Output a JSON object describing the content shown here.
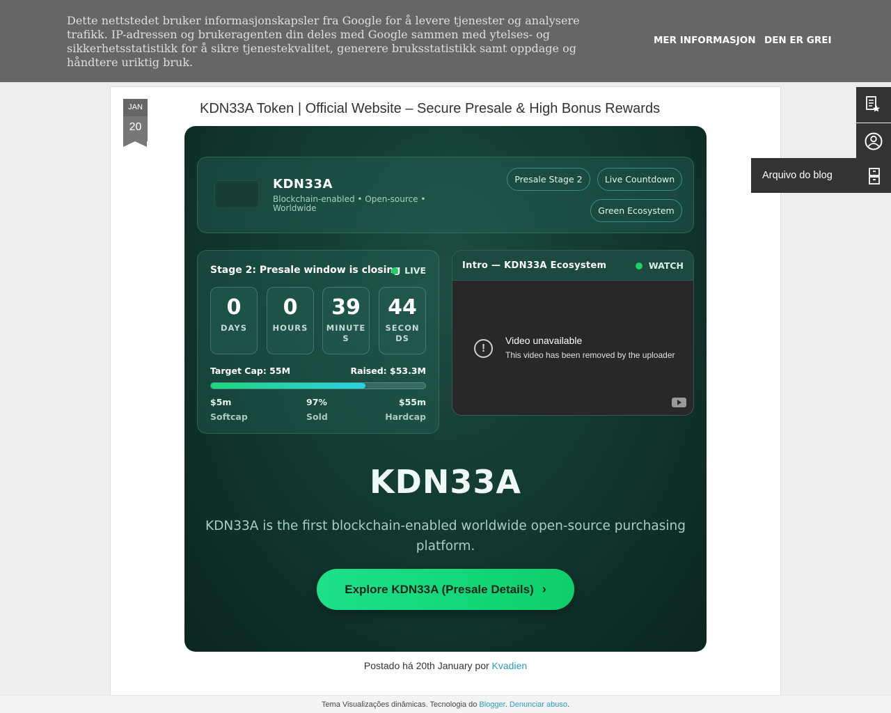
{
  "cookie": {
    "text": "Dette nettstedet bruker informasjonskapsler fra Google for å levere tjenester og analysere trafikk. IP-adressen og brukeragenten din deles med Google sammen med ytelses- og sikkerhetsstatistikk for å sikre tjenestekvalitet, generere bruksstatistikk samt oppdage og håndtere uriktig bruk.",
    "more_label": "MER INFORMASJON",
    "ok_label": "DEN ER GREI"
  },
  "post": {
    "month": "JAN",
    "day": "20",
    "title": "KDN33A Token | Official Website – Secure Presale & High Bonus Rewards",
    "byline_prefix": "Postado há 20th January por ",
    "author": "Kvadien"
  },
  "hero": {
    "brand": "KDN33A",
    "tags": "Blockchain-enabled  •  Open-source  •  Worldwide",
    "pills": [
      "Presale Stage 2",
      "Live Countdown",
      "Green Ecosystem"
    ],
    "countdown": {
      "title": "Stage 2: Presale window is closing",
      "status": "LIVE",
      "units": [
        {
          "value": "0",
          "label": "DAYS"
        },
        {
          "value": "0",
          "label": "HOURS"
        },
        {
          "value": "39",
          "label": "MINUTES"
        },
        {
          "value": "44",
          "label": "SECONDS"
        }
      ],
      "target_cap": "Target Cap: 55M",
      "raised": "Raised: $53.3M",
      "progress_percent": 72,
      "softcap_value": "$5m",
      "softcap_label": "Softcap",
      "sold_value": "97%",
      "sold_label": "Sold",
      "hardcap_value": "$55m",
      "hardcap_label": "Hardcap"
    },
    "video": {
      "title": "Intro — KDN33A Ecosystem",
      "status": "WATCH",
      "message": "Video unavailable",
      "sub": "This video has been removed by the uploader"
    },
    "headline": "KDN33A",
    "description": "KDN33A is the first blockchain-enabled worldwide open-source purchasing platform.",
    "cta_label": "Explore KDN33A (Presale Details)"
  },
  "sidebar": {
    "archive_label": "Arquivo do blog"
  },
  "footer": {
    "prefix": "Tema Visualizações dinâmicas. Tecnologia do ",
    "blogger": "Blogger",
    "separator": ". ",
    "report": "Denunciar abuso",
    "suffix": "."
  },
  "colors": {
    "accent": "#1ee08a",
    "link": "#2a9bc2",
    "live_dot": "#1fce6b"
  }
}
